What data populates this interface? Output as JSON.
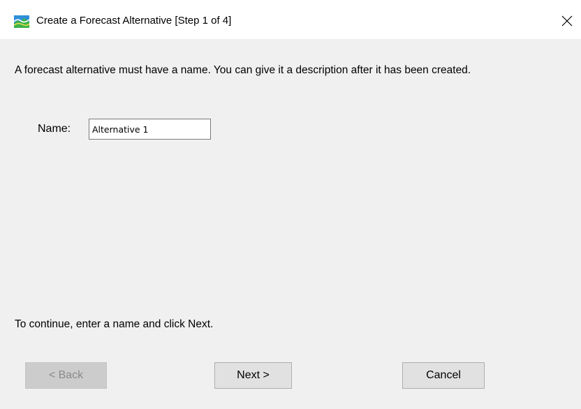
{
  "window": {
    "title": "Create a Forecast Alternative [Step 1 of 4]",
    "icon": "forecast-app-icon",
    "close_icon": "close-icon"
  },
  "content": {
    "intro_text": "A forecast alternative must have a name. You can give it a description after it has been created.",
    "name_label": "Name:",
    "name_value": "Alternative 1",
    "hint_text": "To continue, enter a name and click Next."
  },
  "buttons": {
    "back_label": "< Back",
    "next_label": "Next >",
    "cancel_label": "Cancel"
  },
  "colors": {
    "background": "#f0f0f0",
    "titlebar": "#ffffff",
    "button_face": "#e1e1e1",
    "disabled_text": "#8a8a8a"
  }
}
